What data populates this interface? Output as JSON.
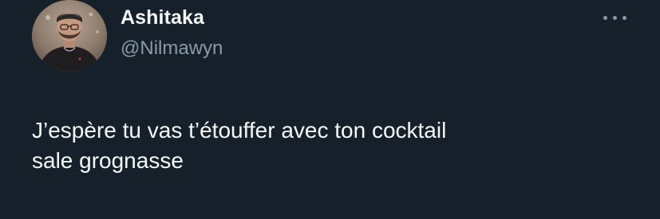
{
  "tweet": {
    "author": {
      "display_name": "Ashitaka",
      "handle": "@Nilmawyn",
      "avatar_icon": "profile-photo-avatar"
    },
    "more_icon": "more-horizontal-icon",
    "text": "J’espère tu vas t’étouffer avec ton cocktail\nsale grognasse"
  },
  "colors": {
    "background": "#15202b",
    "primary_text": "#f7f9f9",
    "secondary_text": "#8b98a5"
  }
}
